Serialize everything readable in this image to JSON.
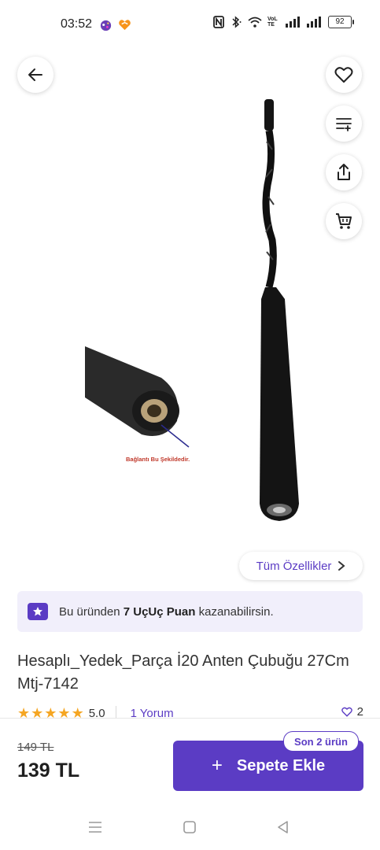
{
  "status_bar": {
    "time": "03:52",
    "network_label": "VoLTE",
    "battery": "92",
    "icons": [
      "game-icon",
      "app-heart-icon",
      "nfc-icon",
      "bluetooth-icon",
      "wifi-icon",
      "signal-icon",
      "signal-icon",
      "battery-icon"
    ]
  },
  "actions": {
    "back": "arrow-left-icon",
    "favorite": "heart-icon",
    "compare": "list-add-icon",
    "share": "share-icon",
    "cart": "cart-icon"
  },
  "product_image": {
    "inset_caption": "Bağlantı Bu Şekildedir."
  },
  "all_features_label": "Tüm Özellikler",
  "points_banner": {
    "prefix": "Bu üründen ",
    "highlight": "7 UçUç Puan",
    "suffix": " kazanabilirsin."
  },
  "product": {
    "title": "Hesaplı_Yedek_Parça İ20 Anten Çubuğu 27Cm Mtj-7142",
    "rating": "5.0",
    "stars": 5,
    "review_link": "1 Yorum",
    "favorite_count": "2"
  },
  "bottom_bar": {
    "old_price": "149 TL",
    "new_price": "139 TL",
    "add_to_cart_label": "Sepete Ekle",
    "stock_badge": "Son 2 ürün"
  },
  "colors": {
    "accent": "#5b3cc4",
    "star": "#f5a623",
    "banner_bg": "#f1effb"
  }
}
